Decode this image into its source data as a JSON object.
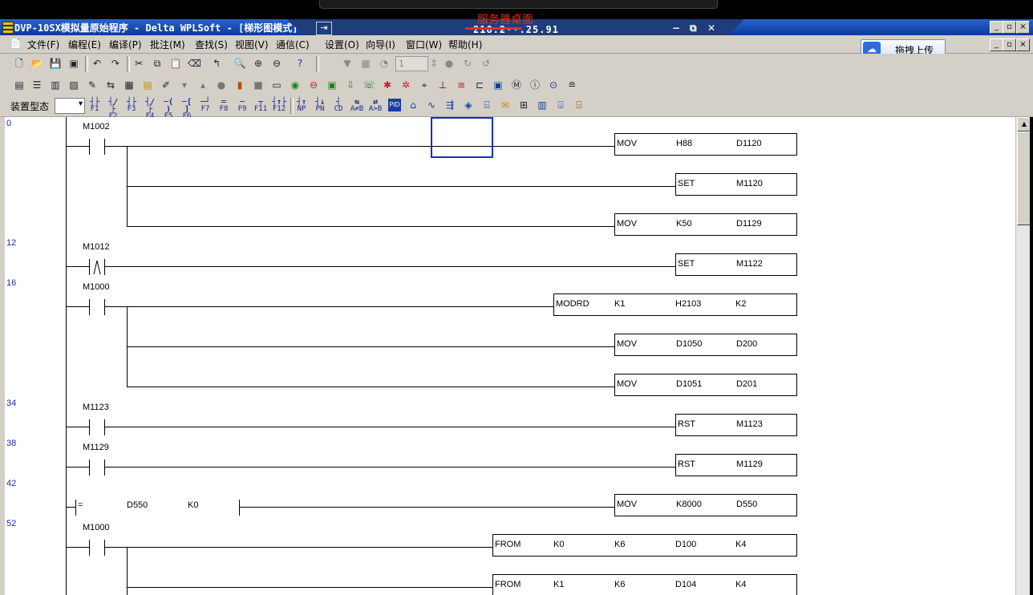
{
  "window": {
    "title": "DVP-10SX模拟量原始程序 - Delta WPLSoft - [梯形图模式]",
    "min": "_",
    "max": "▫",
    "close": "×"
  },
  "remote": {
    "label": "服务器桌面",
    "ip": "218.2··.25.91"
  },
  "menu": {
    "items": [
      "文件(F)",
      "编程(E)",
      "编译(P)",
      "批注(M)",
      "查找(S)",
      "视图(V)",
      "通信(C)",
      "设置(O)",
      "向导(I)",
      "窗口(W)",
      "帮助(H)"
    ]
  },
  "upload": {
    "label": "拖拽上传"
  },
  "toolbar3": {
    "device_label": "装置型态",
    "fkeys": [
      {
        "sym": "┤├",
        "label": "F1"
      },
      {
        "sym": "┤/├",
        "label": "F2"
      },
      {
        "sym": "┤├",
        "label": "F3"
      },
      {
        "sym": "┤/├",
        "label": "F4"
      },
      {
        "sym": "─( )",
        "label": "F5"
      },
      {
        "sym": "─[ ]",
        "label": "F6"
      },
      {
        "sym": "─┘",
        "label": "F7"
      },
      {
        "sym": "═",
        "label": "F8"
      },
      {
        "sym": "─",
        "label": "F9"
      },
      {
        "sym": "┬",
        "label": "F11"
      },
      {
        "sym": "┤↑├",
        "label": "F12"
      }
    ],
    "ops": [
      {
        "sym": "┤↑",
        "label": "NP"
      },
      {
        "sym": "┤↓",
        "label": "PN"
      },
      {
        "sym": "┤",
        "label": "CD"
      },
      {
        "sym": "⇆",
        "label": "A≠B"
      },
      {
        "sym": "⇄",
        "label": "A>B"
      }
    ]
  },
  "toolbar1": {
    "step_value": "1"
  },
  "ladder": {
    "rungs": [
      {
        "step": "0"
      },
      {
        "step": "12"
      },
      {
        "step": "16"
      },
      {
        "step": "34"
      },
      {
        "step": "38"
      },
      {
        "step": "42"
      },
      {
        "step": "52"
      }
    ],
    "contacts": [
      "M1002",
      "M1012",
      "M1000",
      "M1123",
      "M1129",
      "M1000"
    ],
    "compare": {
      "op": "=",
      "s1": "D550",
      "s2": "K0"
    },
    "instructions": [
      {
        "op": "MOV",
        "args": [
          "H88",
          "D1120"
        ]
      },
      {
        "op": "SET",
        "args": [
          "M1120"
        ]
      },
      {
        "op": "MOV",
        "args": [
          "K50",
          "D1129"
        ]
      },
      {
        "op": "SET",
        "args": [
          "M1122"
        ]
      },
      {
        "op": "MODRD",
        "args": [
          "K1",
          "H2103",
          "K2"
        ]
      },
      {
        "op": "MOV",
        "args": [
          "D1050",
          "D200"
        ]
      },
      {
        "op": "MOV",
        "args": [
          "D1051",
          "D201"
        ]
      },
      {
        "op": "RST",
        "args": [
          "M1123"
        ]
      },
      {
        "op": "RST",
        "args": [
          "M1129"
        ]
      },
      {
        "op": "MOV",
        "args": [
          "K8000",
          "D550"
        ]
      },
      {
        "op": "FROM",
        "args": [
          "K0",
          "K6",
          "D100",
          "K4"
        ]
      },
      {
        "op": "FROM",
        "args": [
          "K1",
          "K6",
          "D104",
          "K4"
        ]
      }
    ]
  }
}
